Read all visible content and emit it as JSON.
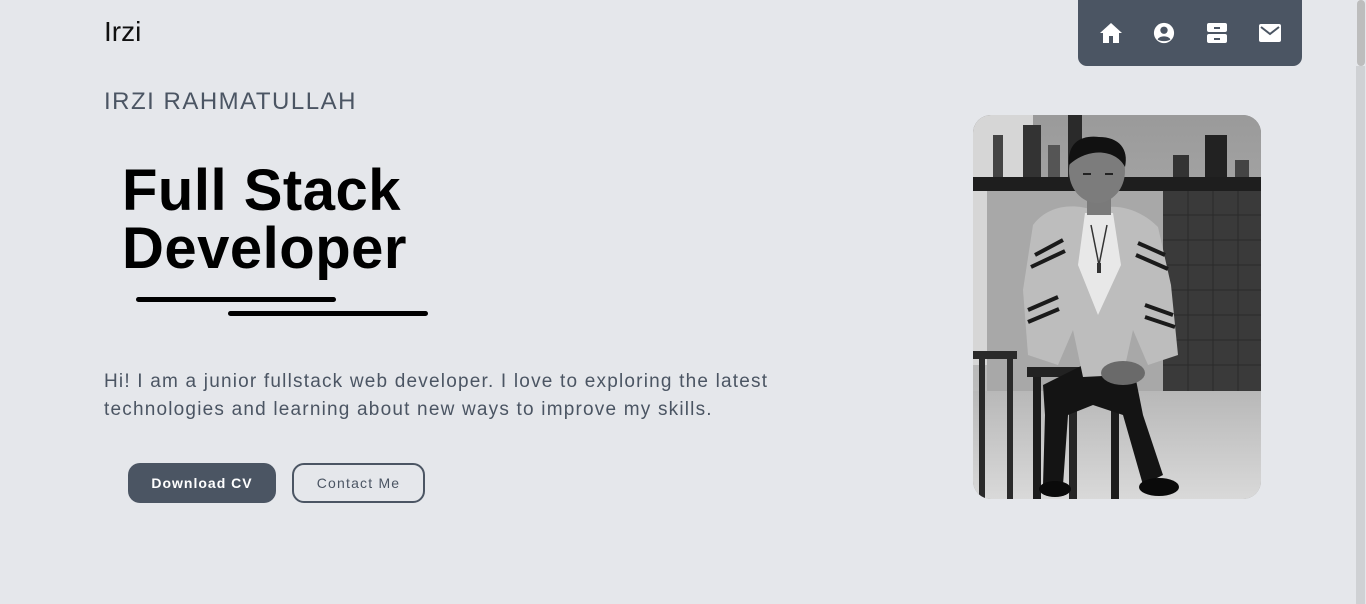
{
  "header": {
    "brand": "Irzi"
  },
  "nav": {
    "items": [
      {
        "name": "nav-home",
        "icon": "home-icon"
      },
      {
        "name": "nav-about",
        "icon": "user-icon"
      },
      {
        "name": "nav-portfolio",
        "icon": "archive-icon"
      },
      {
        "name": "nav-contact",
        "icon": "mail-icon"
      }
    ]
  },
  "hero": {
    "name": "IRZI RAHMATULLAH",
    "title_line1": "Full Stack",
    "title_line2": "Developer",
    "intro": "Hi! I am a junior fullstack web developer. I love to exploring the latest technologies and learning about new ways to improve my skills.",
    "download_label": "Download CV",
    "contact_label": "Contact Me"
  },
  "portrait": {
    "image": "grayscale-photo-of-seated-man"
  },
  "colors": {
    "background": "#e5e7eb",
    "nav_bg": "#4b5563",
    "accent_text": "#4b5563",
    "heading": "#000000"
  }
}
